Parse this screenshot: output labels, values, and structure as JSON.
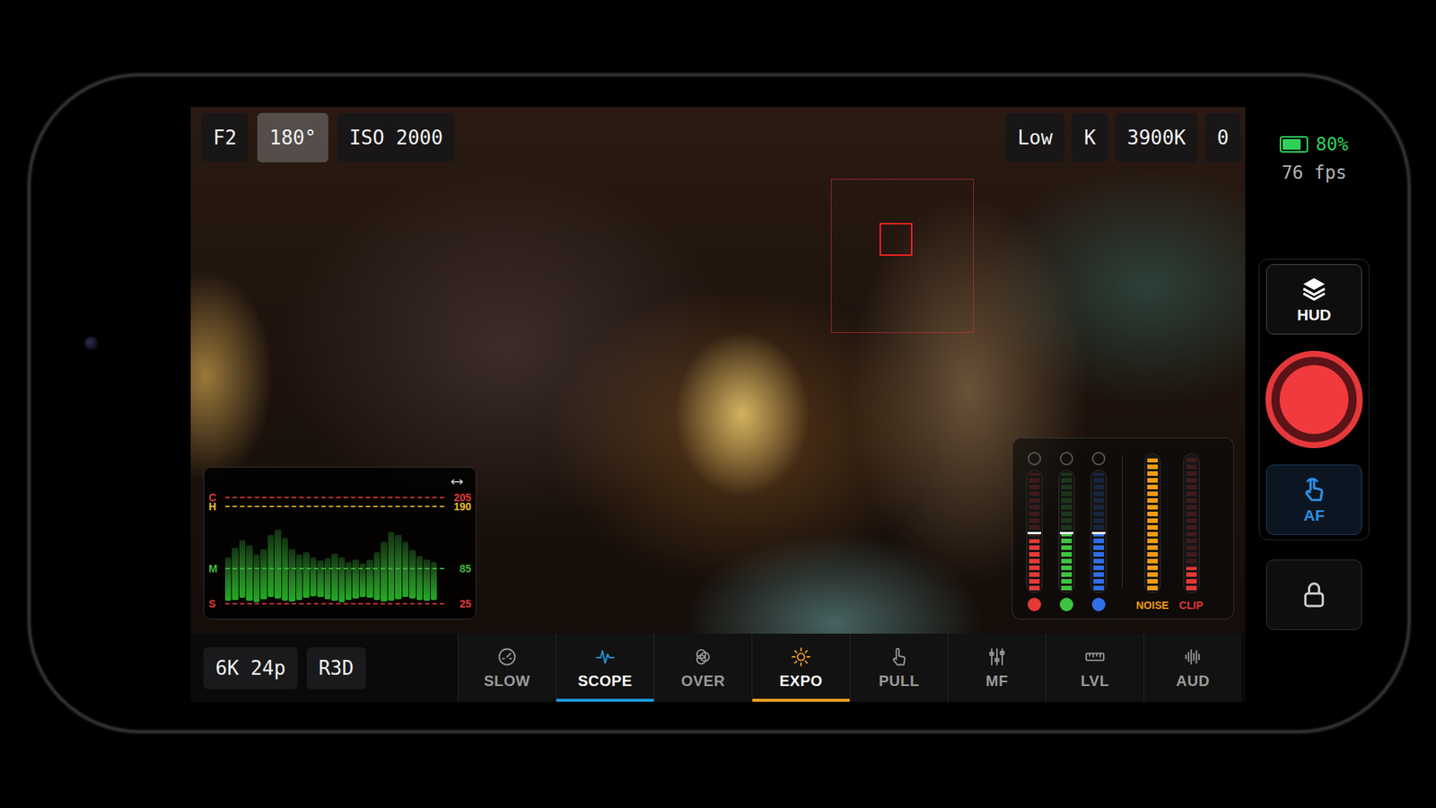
{
  "exposure_chips": [
    {
      "label": "F2",
      "selected": false
    },
    {
      "label": "180°",
      "selected": true
    },
    {
      "label": "ISO 2000",
      "selected": false
    }
  ],
  "color_chips": [
    {
      "label": "Low"
    },
    {
      "label": "K"
    },
    {
      "label": "3900K"
    },
    {
      "label": "0"
    }
  ],
  "status": {
    "battery": "80%",
    "battery_level": 0.8,
    "fps": "76 fps"
  },
  "side_buttons": [
    {
      "label": "HUD",
      "kind": "layers",
      "color": "#ffffff"
    },
    {
      "label": "AF",
      "kind": "touch",
      "color": "#2f8fe6"
    }
  ],
  "record": {
    "recording": false
  },
  "lock": {
    "locked": true
  },
  "format": [
    "6K 24p",
    "R3D"
  ],
  "tabs": [
    {
      "label": "SLOW",
      "selected": false,
      "color": "#1e9be0"
    },
    {
      "label": "SCOPE",
      "selected": true,
      "color": "#1e9be0"
    },
    {
      "label": "OVER",
      "selected": false,
      "color": "#1e9be0"
    },
    {
      "label": "EXPO",
      "selected": true,
      "color": "#f0a020"
    },
    {
      "label": "PULL",
      "selected": false,
      "color": "#1e9be0"
    },
    {
      "label": "MF",
      "selected": false,
      "color": "#1e9be0"
    },
    {
      "label": "LVL",
      "selected": false,
      "color": "#1e9be0"
    },
    {
      "label": "AUD",
      "selected": false,
      "color": "#1e9be0"
    }
  ],
  "waveform": {
    "lines": [
      {
        "mark": "C",
        "value": "205",
        "level": 205,
        "color": "#e03a3a"
      },
      {
        "mark": "H",
        "value": "190",
        "level": 190,
        "color": "#e8c020"
      },
      {
        "mark": "M",
        "value": "85",
        "level": 85,
        "color": "#3fbf3f"
      },
      {
        "mark": "S",
        "value": "25",
        "level": 25,
        "color": "#e03a3a"
      }
    ],
    "columns": [
      {
        "base": 30,
        "peak": 104
      },
      {
        "base": 32,
        "peak": 120
      },
      {
        "base": 35,
        "peak": 132
      },
      {
        "base": 30,
        "peak": 124
      },
      {
        "base": 28,
        "peak": 108
      },
      {
        "base": 33,
        "peak": 118
      },
      {
        "base": 36,
        "peak": 142
      },
      {
        "base": 34,
        "peak": 150
      },
      {
        "base": 30,
        "peak": 136
      },
      {
        "base": 29,
        "peak": 118
      },
      {
        "base": 31,
        "peak": 108
      },
      {
        "base": 35,
        "peak": 112
      },
      {
        "base": 38,
        "peak": 104
      },
      {
        "base": 36,
        "peak": 98
      },
      {
        "base": 33,
        "peak": 102
      },
      {
        "base": 30,
        "peak": 110
      },
      {
        "base": 28,
        "peak": 104
      },
      {
        "base": 32,
        "peak": 96
      },
      {
        "base": 34,
        "peak": 100
      },
      {
        "base": 37,
        "peak": 94
      },
      {
        "base": 35,
        "peak": 100
      },
      {
        "base": 31,
        "peak": 112
      },
      {
        "base": 29,
        "peak": 130
      },
      {
        "base": 30,
        "peak": 146
      },
      {
        "base": 33,
        "peak": 142
      },
      {
        "base": 36,
        "peak": 130
      },
      {
        "base": 34,
        "peak": 116
      },
      {
        "base": 31,
        "peak": 106
      },
      {
        "base": 30,
        "peak": 100
      },
      {
        "base": 32,
        "peak": 96
      }
    ]
  },
  "meters": {
    "channels": [
      {
        "level": 0.42,
        "marker": 0.48,
        "color": "#e53935"
      },
      {
        "level": 0.48,
        "marker": 0.48,
        "color": "#3fc43f"
      },
      {
        "level": 0.46,
        "marker": 0.48,
        "color": "#2f6fe8"
      }
    ],
    "gauges": [
      {
        "label": "NOISE",
        "level": 0.95,
        "color": "#f39c12"
      },
      {
        "label": "CLIP",
        "level": 0.17,
        "color": "#e53935"
      }
    ]
  }
}
